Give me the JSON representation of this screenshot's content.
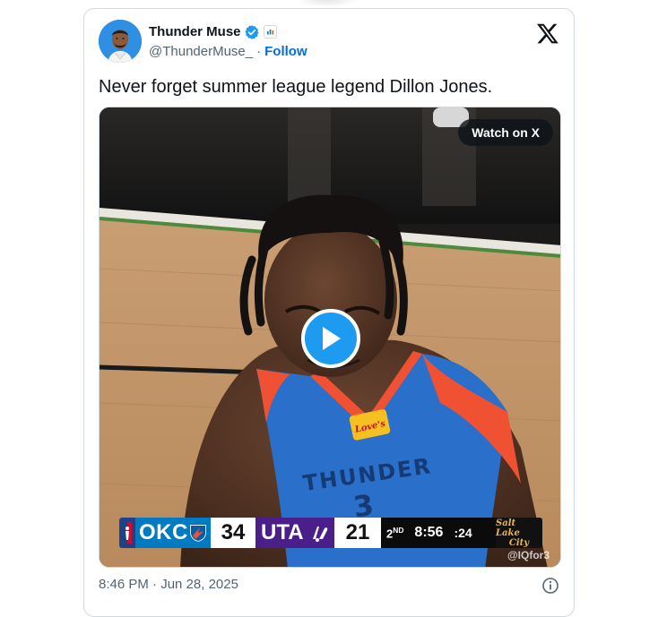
{
  "tweet": {
    "author": {
      "display_name": "Thunder Muse",
      "handle": "@ThunderMuse_",
      "separator": "·",
      "follow_label": "Follow",
      "verified_color": "#1d9bf0",
      "avatar_bg": "#2f8fe3"
    },
    "text": "Never forget summer league legend Dillon Jones.",
    "media": {
      "watch_label": "Watch on X",
      "watermark": "@IQfor3",
      "scoreboard": {
        "home_team": "OKC",
        "home_score": "34",
        "home_color": "#007ac1",
        "away_team": "UTA",
        "away_score": "21",
        "away_color": "#4b1f89",
        "period": "2",
        "period_suffix": "ND",
        "clock": "8:56",
        "shot_clock": ":24",
        "venue_line1": "Salt Lake",
        "venue_line2": "City"
      },
      "jersey": {
        "text": "THUNDER",
        "number": "3",
        "sponsor": "Love's"
      }
    },
    "timestamp": "8:46 PM · Jun 28, 2025",
    "brand_accent": "#1d9bf0",
    "link_color": "#006fd6",
    "icons": [
      "verified-badge-icon",
      "affiliate-badge-icon",
      "x-logo-icon",
      "play-icon",
      "info-icon"
    ]
  }
}
